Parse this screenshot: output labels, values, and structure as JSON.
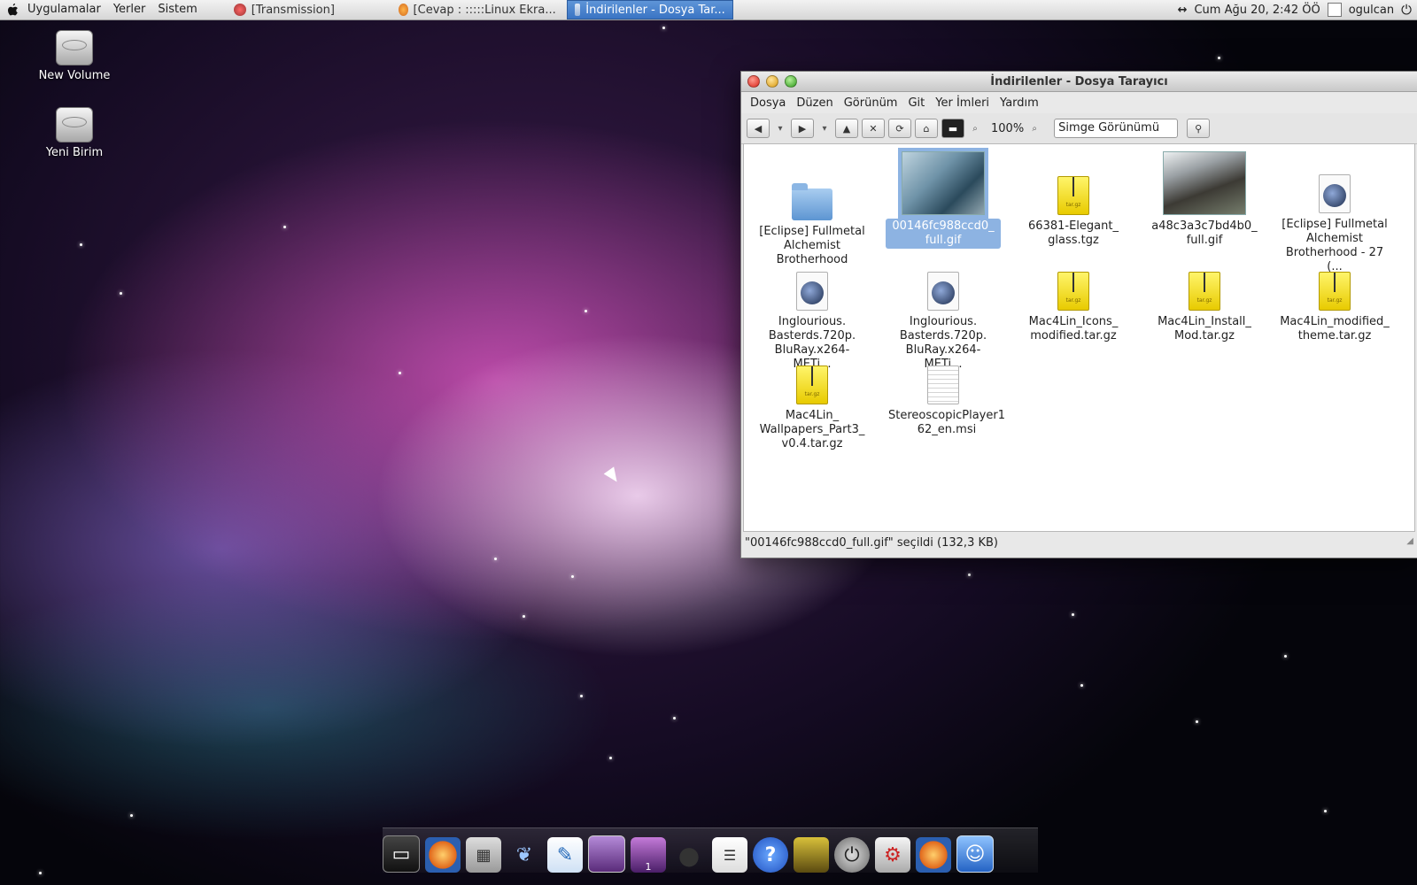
{
  "top_panel": {
    "menus": [
      "Uygulamalar",
      "Yerler",
      "Sistem"
    ],
    "tasks": [
      {
        "label": "[Transmission]",
        "active": false
      },
      {
        "label": "[Cevap : :::::Linux Ekra...",
        "active": false
      },
      {
        "label": "İndirilenler - Dosya Tar...",
        "active": true
      }
    ],
    "clock": "Cum Ağu 20,  2:42 ÖÖ",
    "user": "ogulcan"
  },
  "desktop_icons": [
    {
      "label": "New Volume"
    },
    {
      "label": "Yeni Birim"
    }
  ],
  "window": {
    "title": "İndirilenler - Dosya Tarayıcı",
    "menus": [
      "Dosya",
      "Düzen",
      "Görünüm",
      "Git",
      "Yer İmleri",
      "Yardım"
    ],
    "zoom": "100%",
    "view_mode": "Simge Görünümü",
    "files": [
      {
        "name": "[Eclipse] Fullmetal Alchemist Brotherhood",
        "type": "folder",
        "selected": false
      },
      {
        "name": "00146fc988ccd0_ full.gif",
        "type": "image-a",
        "selected": true
      },
      {
        "name": "66381-Elegant_ glass.tgz",
        "type": "archive",
        "selected": false
      },
      {
        "name": "a48c3a3c7bd4b0_ full.gif",
        "type": "image-b",
        "selected": false
      },
      {
        "name": "[Eclipse] Fullmetal Alchemist Brotherhood - 27 (...",
        "type": "media",
        "selected": false
      },
      {
        "name": "Inglourious. Basterds.720p. BluRay.x264-METi...",
        "type": "media",
        "selected": false
      },
      {
        "name": "Inglourious. Basterds.720p. BluRay.x264-METi...",
        "type": "media",
        "selected": false
      },
      {
        "name": "Mac4Lin_Icons_ modified.tar.gz",
        "type": "archive",
        "selected": false
      },
      {
        "name": "Mac4Lin_Install_ Mod.tar.gz",
        "type": "archive",
        "selected": false
      },
      {
        "name": "Mac4Lin_modified_ theme.tar.gz",
        "type": "archive",
        "selected": false
      },
      {
        "name": "Mac4Lin_ Wallpapers_Part3_ v0.4.tar.gz",
        "type": "archive",
        "selected": false
      },
      {
        "name": "StereoscopicPlayer1 62_en.msi",
        "type": "document",
        "selected": false
      }
    ],
    "status": "\"00146fc988ccd0_full.gif\" seçildi (132,3 KB)"
  },
  "dock": {
    "items": [
      "terminal-icon",
      "firefox-icon",
      "calculator-icon",
      "pidgin-icon",
      "inkscape-icon",
      "wallpaper-icon",
      "workspace-switcher-icon",
      "apple-icon",
      "text-editor-icon",
      "help-icon",
      "photo-viewer-icon",
      "power-icon",
      "system-prefs-icon",
      "firefox-icon",
      "finder-icon"
    ],
    "badge": "1"
  }
}
